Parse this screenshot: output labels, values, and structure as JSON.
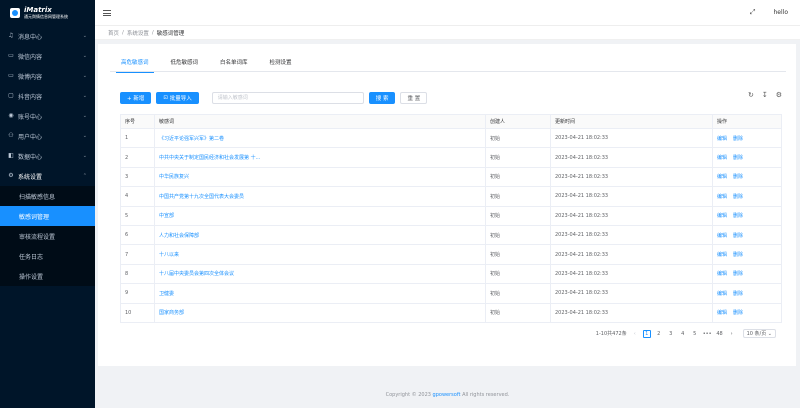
{
  "app": {
    "title": "iMatrix",
    "subtitle": "通元舆情信息网管理系统"
  },
  "sidebar": {
    "items": [
      {
        "label": "消息中心",
        "icon": "bell-icon"
      },
      {
        "label": "微信内容",
        "icon": "comment-icon"
      },
      {
        "label": "微博内容",
        "icon": "message-icon"
      },
      {
        "label": "抖音内容",
        "icon": "video-icon"
      },
      {
        "label": "账号中心",
        "icon": "location-icon"
      },
      {
        "label": "用户中心",
        "icon": "user-icon"
      },
      {
        "label": "数据中心",
        "icon": "data-icon"
      },
      {
        "label": "系统设置",
        "icon": "gear-icon"
      }
    ],
    "subitems": [
      "扫描敏感信息",
      "敏感词管理",
      "审核流程设置",
      "任务日志",
      "操作设置"
    ]
  },
  "topbar": {
    "user": "hello"
  },
  "breadcrumb": [
    "首页",
    "系统设置",
    "敏感词管理"
  ],
  "tabs": [
    "高危敏感词",
    "低危敏感词",
    "白名单词库",
    "检测设置"
  ],
  "toolbar": {
    "add_label": "+ 新增",
    "import_label": "批量导入",
    "search_placeholder": "请输入敏感词",
    "search_label": "搜 索",
    "reset_label": "重 置"
  },
  "table": {
    "headers": [
      "序号",
      "敏感词",
      "创建人",
      "更新时间",
      "操作"
    ],
    "edit_label": "编辑",
    "delete_label": "删除",
    "rows": [
      {
        "no": "1",
        "word": "《习近平论强军兴军》第二卷",
        "creator": "初始",
        "time": "2023-04-21 18:02:33"
      },
      {
        "no": "2",
        "word": "中共中央关于制定国民经济和社会发展第 十...",
        "creator": "初始",
        "time": "2023-04-21 18:02:33"
      },
      {
        "no": "3",
        "word": "中华民族复兴",
        "creator": "初始",
        "time": "2023-04-21 18:02:33"
      },
      {
        "no": "4",
        "word": "中国共产党第十九次全国代表大会委员",
        "creator": "初始",
        "time": "2023-04-21 18:02:33"
      },
      {
        "no": "5",
        "word": "中宣部",
        "creator": "初始",
        "time": "2023-04-21 18:02:33"
      },
      {
        "no": "6",
        "word": "人力和社会保障部",
        "creator": "初始",
        "time": "2023-04-21 18:02:33"
      },
      {
        "no": "7",
        "word": "十八以来",
        "creator": "初始",
        "time": "2023-04-21 18:02:33"
      },
      {
        "no": "8",
        "word": "十八届中央委员会第四次全体会议",
        "creator": "初始",
        "time": "2023-04-21 18:02:33"
      },
      {
        "no": "9",
        "word": "卫健委",
        "creator": "初始",
        "time": "2023-04-21 18:02:33"
      },
      {
        "no": "10",
        "word": "国家商务部",
        "creator": "初始",
        "time": "2023-04-21 18:02:33"
      }
    ]
  },
  "pagination": {
    "summary": "1-10共472条",
    "pages": [
      "1",
      "2",
      "3",
      "4",
      "5",
      "•••",
      "48"
    ],
    "current": "1",
    "size": "10 条/页"
  },
  "footer": {
    "prefix": "Copyright © 2023",
    "link": "gpowersoft",
    "suffix": "All rights reserved."
  }
}
